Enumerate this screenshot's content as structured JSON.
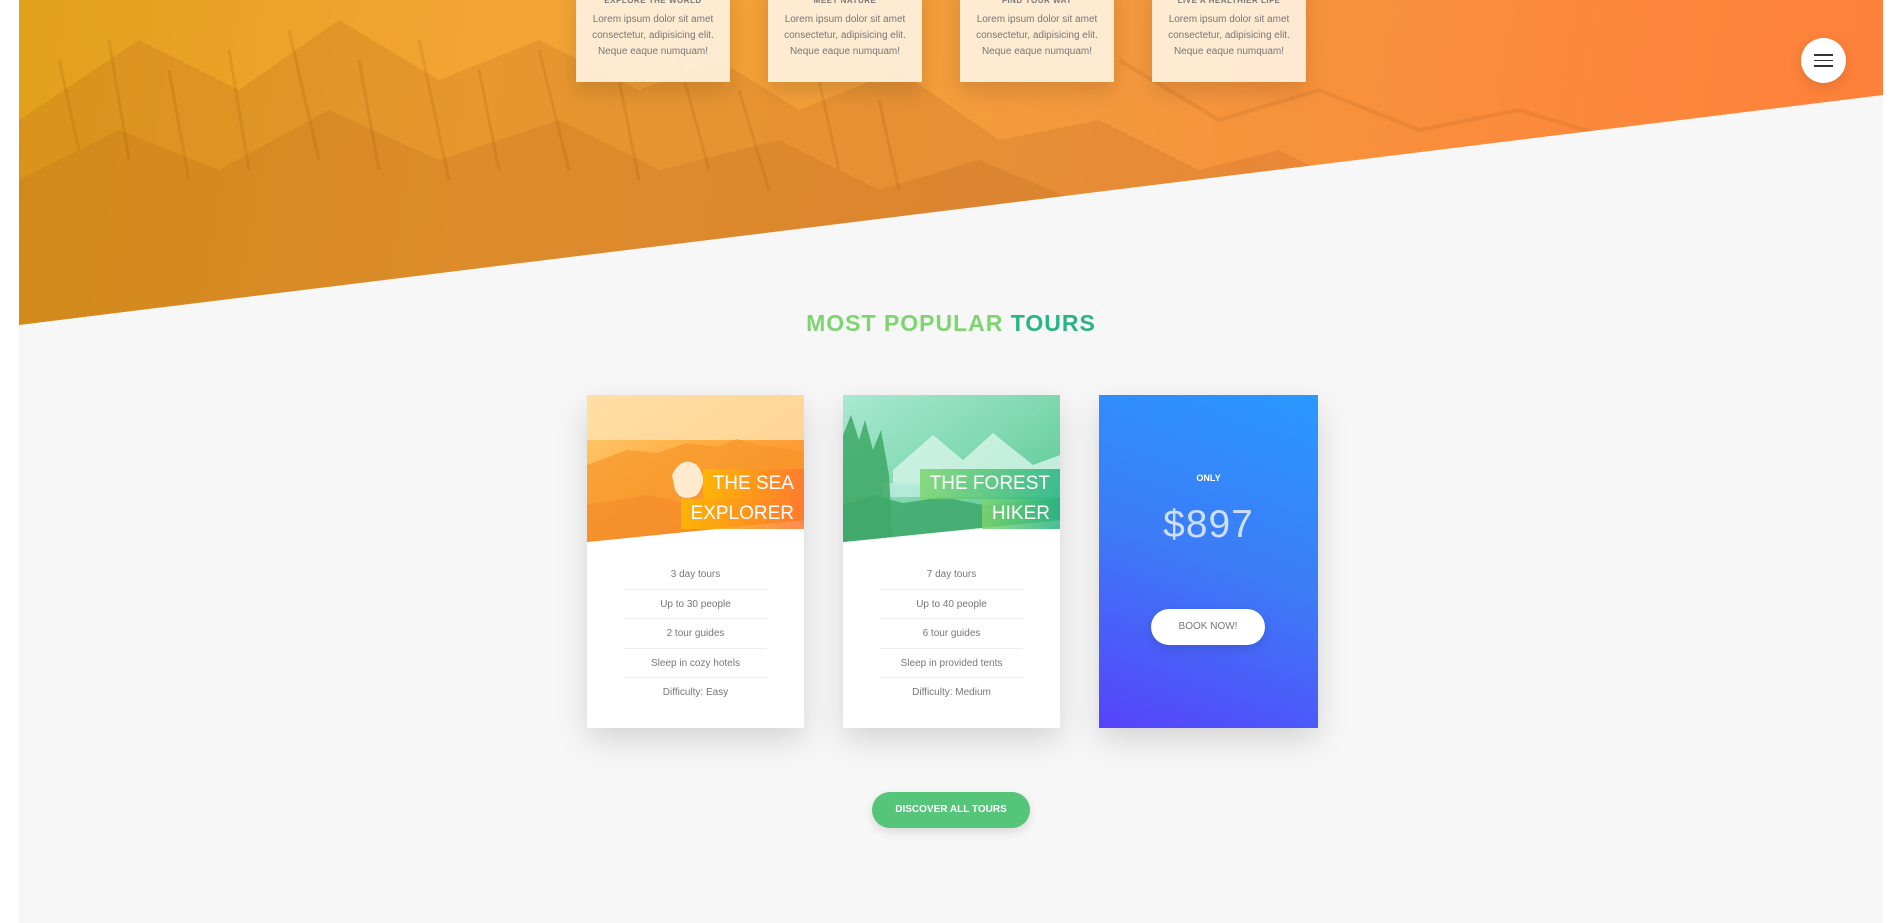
{
  "features": [
    {
      "title": "Explore the world",
      "text": "Lorem ipsum dolor sit amet consectetur, adipisicing elit. Neque eaque numquam!"
    },
    {
      "title": "Meet nature",
      "text": "Lorem ipsum dolor sit amet consectetur, adipisicing elit. Neque eaque numquam!"
    },
    {
      "title": "Find your way",
      "text": "Lorem ipsum dolor sit amet consectetur, adipisicing elit. Neque eaque numquam!"
    },
    {
      "title": "Live a healthier life",
      "text": "Lorem ipsum dolor sit amet consectetur, adipisicing elit. Neque eaque numquam!"
    }
  ],
  "menu": {
    "icon": "hamburger-menu-icon"
  },
  "section": {
    "title_part1": "Most popular",
    "title_part2": "tours"
  },
  "tours": [
    {
      "name_line1": "The Sea",
      "name_line2": "Explorer",
      "details": [
        "3 day tours",
        "Up to 30 people",
        "2 tour guides",
        "Sleep in cozy hotels",
        "Difficulty: Easy"
      ]
    },
    {
      "name_line1": "The Forest",
      "name_line2": "Hiker",
      "details": [
        "7 day tours",
        "Up to 40 people",
        "6 tour guides",
        "Sleep in provided tents",
        "Difficulty: Medium"
      ]
    }
  ],
  "price_card": {
    "only_label": "Only",
    "price": "$897",
    "button_label": "Book now!"
  },
  "discover_button": {
    "label": "Discover all tours"
  },
  "colors": {
    "green_light": "#7ed56f",
    "green_dark": "#28b485",
    "green_button": "#55c57a",
    "orange_light": "#ffb900",
    "orange_dark": "#ff7730",
    "blue_light": "#2998ff",
    "blue_dark": "#5643fa"
  }
}
